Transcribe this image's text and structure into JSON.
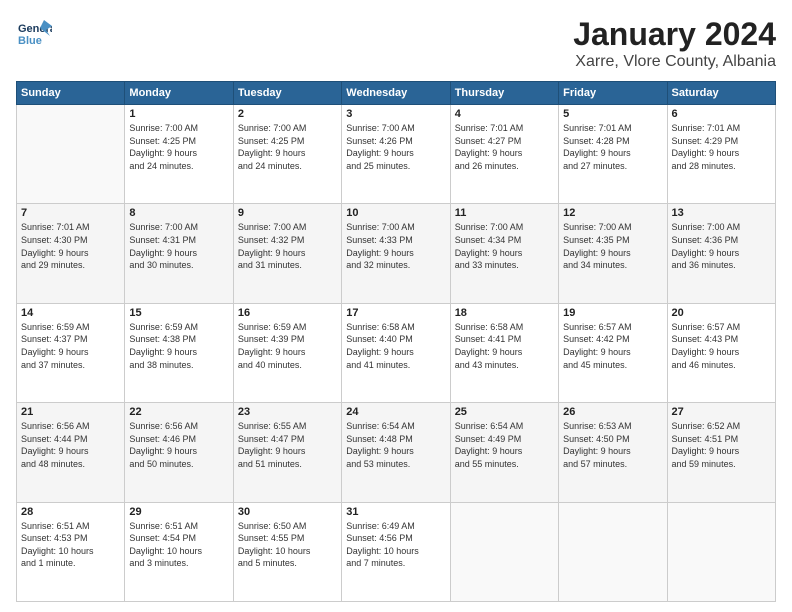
{
  "logo": {
    "line1": "General",
    "line2": "Blue"
  },
  "title": "January 2024",
  "subtitle": "Xarre, Vlore County, Albania",
  "weekdays": [
    "Sunday",
    "Monday",
    "Tuesday",
    "Wednesday",
    "Thursday",
    "Friday",
    "Saturday"
  ],
  "weeks": [
    [
      {
        "day": "",
        "info": ""
      },
      {
        "day": "1",
        "info": "Sunrise: 7:00 AM\nSunset: 4:25 PM\nDaylight: 9 hours\nand 24 minutes."
      },
      {
        "day": "2",
        "info": "Sunrise: 7:00 AM\nSunset: 4:25 PM\nDaylight: 9 hours\nand 24 minutes."
      },
      {
        "day": "3",
        "info": "Sunrise: 7:00 AM\nSunset: 4:26 PM\nDaylight: 9 hours\nand 25 minutes."
      },
      {
        "day": "4",
        "info": "Sunrise: 7:01 AM\nSunset: 4:27 PM\nDaylight: 9 hours\nand 26 minutes."
      },
      {
        "day": "5",
        "info": "Sunrise: 7:01 AM\nSunset: 4:28 PM\nDaylight: 9 hours\nand 27 minutes."
      },
      {
        "day": "6",
        "info": "Sunrise: 7:01 AM\nSunset: 4:29 PM\nDaylight: 9 hours\nand 28 minutes."
      }
    ],
    [
      {
        "day": "7",
        "info": "Sunrise: 7:01 AM\nSunset: 4:30 PM\nDaylight: 9 hours\nand 29 minutes."
      },
      {
        "day": "8",
        "info": "Sunrise: 7:00 AM\nSunset: 4:31 PM\nDaylight: 9 hours\nand 30 minutes."
      },
      {
        "day": "9",
        "info": "Sunrise: 7:00 AM\nSunset: 4:32 PM\nDaylight: 9 hours\nand 31 minutes."
      },
      {
        "day": "10",
        "info": "Sunrise: 7:00 AM\nSunset: 4:33 PM\nDaylight: 9 hours\nand 32 minutes."
      },
      {
        "day": "11",
        "info": "Sunrise: 7:00 AM\nSunset: 4:34 PM\nDaylight: 9 hours\nand 33 minutes."
      },
      {
        "day": "12",
        "info": "Sunrise: 7:00 AM\nSunset: 4:35 PM\nDaylight: 9 hours\nand 34 minutes."
      },
      {
        "day": "13",
        "info": "Sunrise: 7:00 AM\nSunset: 4:36 PM\nDaylight: 9 hours\nand 36 minutes."
      }
    ],
    [
      {
        "day": "14",
        "info": "Sunrise: 6:59 AM\nSunset: 4:37 PM\nDaylight: 9 hours\nand 37 minutes."
      },
      {
        "day": "15",
        "info": "Sunrise: 6:59 AM\nSunset: 4:38 PM\nDaylight: 9 hours\nand 38 minutes."
      },
      {
        "day": "16",
        "info": "Sunrise: 6:59 AM\nSunset: 4:39 PM\nDaylight: 9 hours\nand 40 minutes."
      },
      {
        "day": "17",
        "info": "Sunrise: 6:58 AM\nSunset: 4:40 PM\nDaylight: 9 hours\nand 41 minutes."
      },
      {
        "day": "18",
        "info": "Sunrise: 6:58 AM\nSunset: 4:41 PM\nDaylight: 9 hours\nand 43 minutes."
      },
      {
        "day": "19",
        "info": "Sunrise: 6:57 AM\nSunset: 4:42 PM\nDaylight: 9 hours\nand 45 minutes."
      },
      {
        "day": "20",
        "info": "Sunrise: 6:57 AM\nSunset: 4:43 PM\nDaylight: 9 hours\nand 46 minutes."
      }
    ],
    [
      {
        "day": "21",
        "info": "Sunrise: 6:56 AM\nSunset: 4:44 PM\nDaylight: 9 hours\nand 48 minutes."
      },
      {
        "day": "22",
        "info": "Sunrise: 6:56 AM\nSunset: 4:46 PM\nDaylight: 9 hours\nand 50 minutes."
      },
      {
        "day": "23",
        "info": "Sunrise: 6:55 AM\nSunset: 4:47 PM\nDaylight: 9 hours\nand 51 minutes."
      },
      {
        "day": "24",
        "info": "Sunrise: 6:54 AM\nSunset: 4:48 PM\nDaylight: 9 hours\nand 53 minutes."
      },
      {
        "day": "25",
        "info": "Sunrise: 6:54 AM\nSunset: 4:49 PM\nDaylight: 9 hours\nand 55 minutes."
      },
      {
        "day": "26",
        "info": "Sunrise: 6:53 AM\nSunset: 4:50 PM\nDaylight: 9 hours\nand 57 minutes."
      },
      {
        "day": "27",
        "info": "Sunrise: 6:52 AM\nSunset: 4:51 PM\nDaylight: 9 hours\nand 59 minutes."
      }
    ],
    [
      {
        "day": "28",
        "info": "Sunrise: 6:51 AM\nSunset: 4:53 PM\nDaylight: 10 hours\nand 1 minute."
      },
      {
        "day": "29",
        "info": "Sunrise: 6:51 AM\nSunset: 4:54 PM\nDaylight: 10 hours\nand 3 minutes."
      },
      {
        "day": "30",
        "info": "Sunrise: 6:50 AM\nSunset: 4:55 PM\nDaylight: 10 hours\nand 5 minutes."
      },
      {
        "day": "31",
        "info": "Sunrise: 6:49 AM\nSunset: 4:56 PM\nDaylight: 10 hours\nand 7 minutes."
      },
      {
        "day": "",
        "info": ""
      },
      {
        "day": "",
        "info": ""
      },
      {
        "day": "",
        "info": ""
      }
    ]
  ]
}
